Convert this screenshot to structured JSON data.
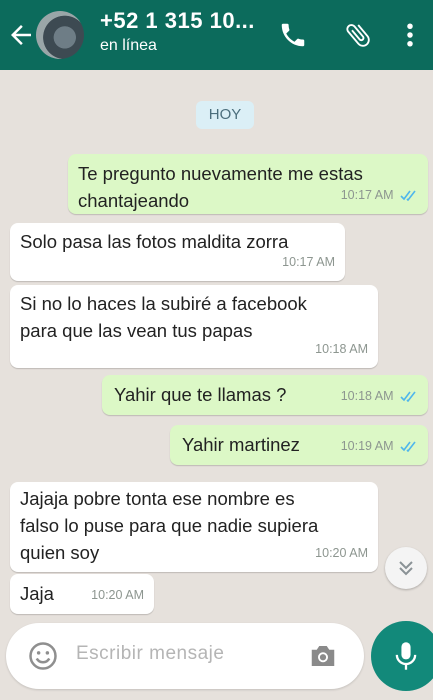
{
  "header": {
    "contact_name": "+52 1 315 10...",
    "status": "en línea"
  },
  "chat": {
    "date_label": "HOY",
    "messages": [
      {
        "direction": "out",
        "text": "Te pregunto nuevamente me estas\nchantajeando",
        "time": "10:17 AM",
        "read": true
      },
      {
        "direction": "in",
        "text": "Solo pasa las fotos maldita zorra",
        "time": "10:17 AM"
      },
      {
        "direction": "in",
        "text": "Si no lo haces la subiré a facebook\npara que las vean tus papas",
        "time": "10:18 AM"
      },
      {
        "direction": "out",
        "text": "Yahir que te llamas ?",
        "time": "10:18 AM",
        "read": true
      },
      {
        "direction": "out",
        "text": "Yahir martinez",
        "time": "10:19 AM",
        "read": true
      },
      {
        "direction": "in",
        "text": "Jajaja pobre tonta ese nombre es\nfalso lo puse para que nadie supiera\nquien soy",
        "time": "10:20 AM"
      },
      {
        "direction": "in",
        "text": "Jaja",
        "time": "10:20 AM"
      }
    ]
  },
  "composer": {
    "placeholder": "Escribir mensaje"
  },
  "icons": {
    "back": "arrow-left-icon",
    "call": "phone-icon",
    "attach": "paperclip-icon",
    "menu": "more-vert-icon",
    "emoji": "emoji-icon",
    "camera": "camera-icon",
    "mic": "mic-icon",
    "scroll": "chevron-double-down-icon",
    "read": "double-check-icon"
  },
  "colors": {
    "header": "#0c6b5c",
    "outgoing_bubble": "#dcf8c6",
    "incoming_bubble": "#ffffff",
    "background": "#e6e1dc",
    "read_ticks": "#4fb6ec",
    "mic_button": "#12897a"
  }
}
